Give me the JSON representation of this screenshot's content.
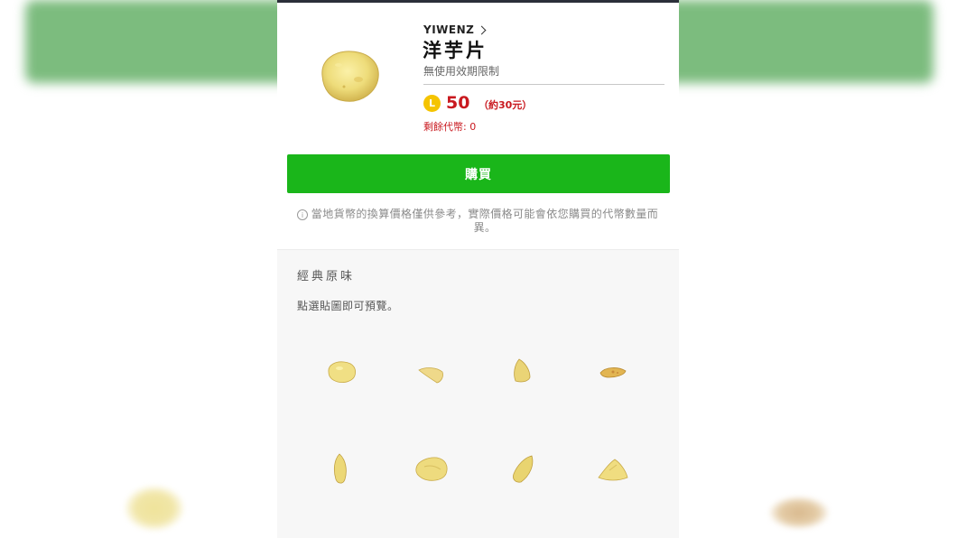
{
  "header": {
    "author": "YIWENZ",
    "title": "洋芋片",
    "validity": "無使用效期限制"
  },
  "price": {
    "coin_symbol": "L",
    "amount": "50",
    "approx": "（約30元）",
    "remaining": "剩餘代幣: 0"
  },
  "buy_button": {
    "label": "購買"
  },
  "note": {
    "icon": "info-icon",
    "text": "當地貨幣的換算價格僅供參考，實際價格可能會依您購買的代幣數量而異。"
  },
  "section": {
    "title": "經典原味",
    "hint": "點選貼圖即可預覽。"
  },
  "colors": {
    "accent_green": "#1ab61a",
    "price_red": "#c9191f",
    "coin_yellow": "#f5c400",
    "background_band": "#7cbc7e"
  },
  "stickers": [
    {
      "icon": "potato-chip-icon"
    },
    {
      "icon": "potato-chip-icon"
    },
    {
      "icon": "potato-chip-icon"
    },
    {
      "icon": "potato-chip-icon"
    },
    {
      "icon": "potato-chip-icon"
    },
    {
      "icon": "potato-chip-icon"
    },
    {
      "icon": "potato-chip-icon"
    },
    {
      "icon": "potato-chip-icon"
    }
  ]
}
